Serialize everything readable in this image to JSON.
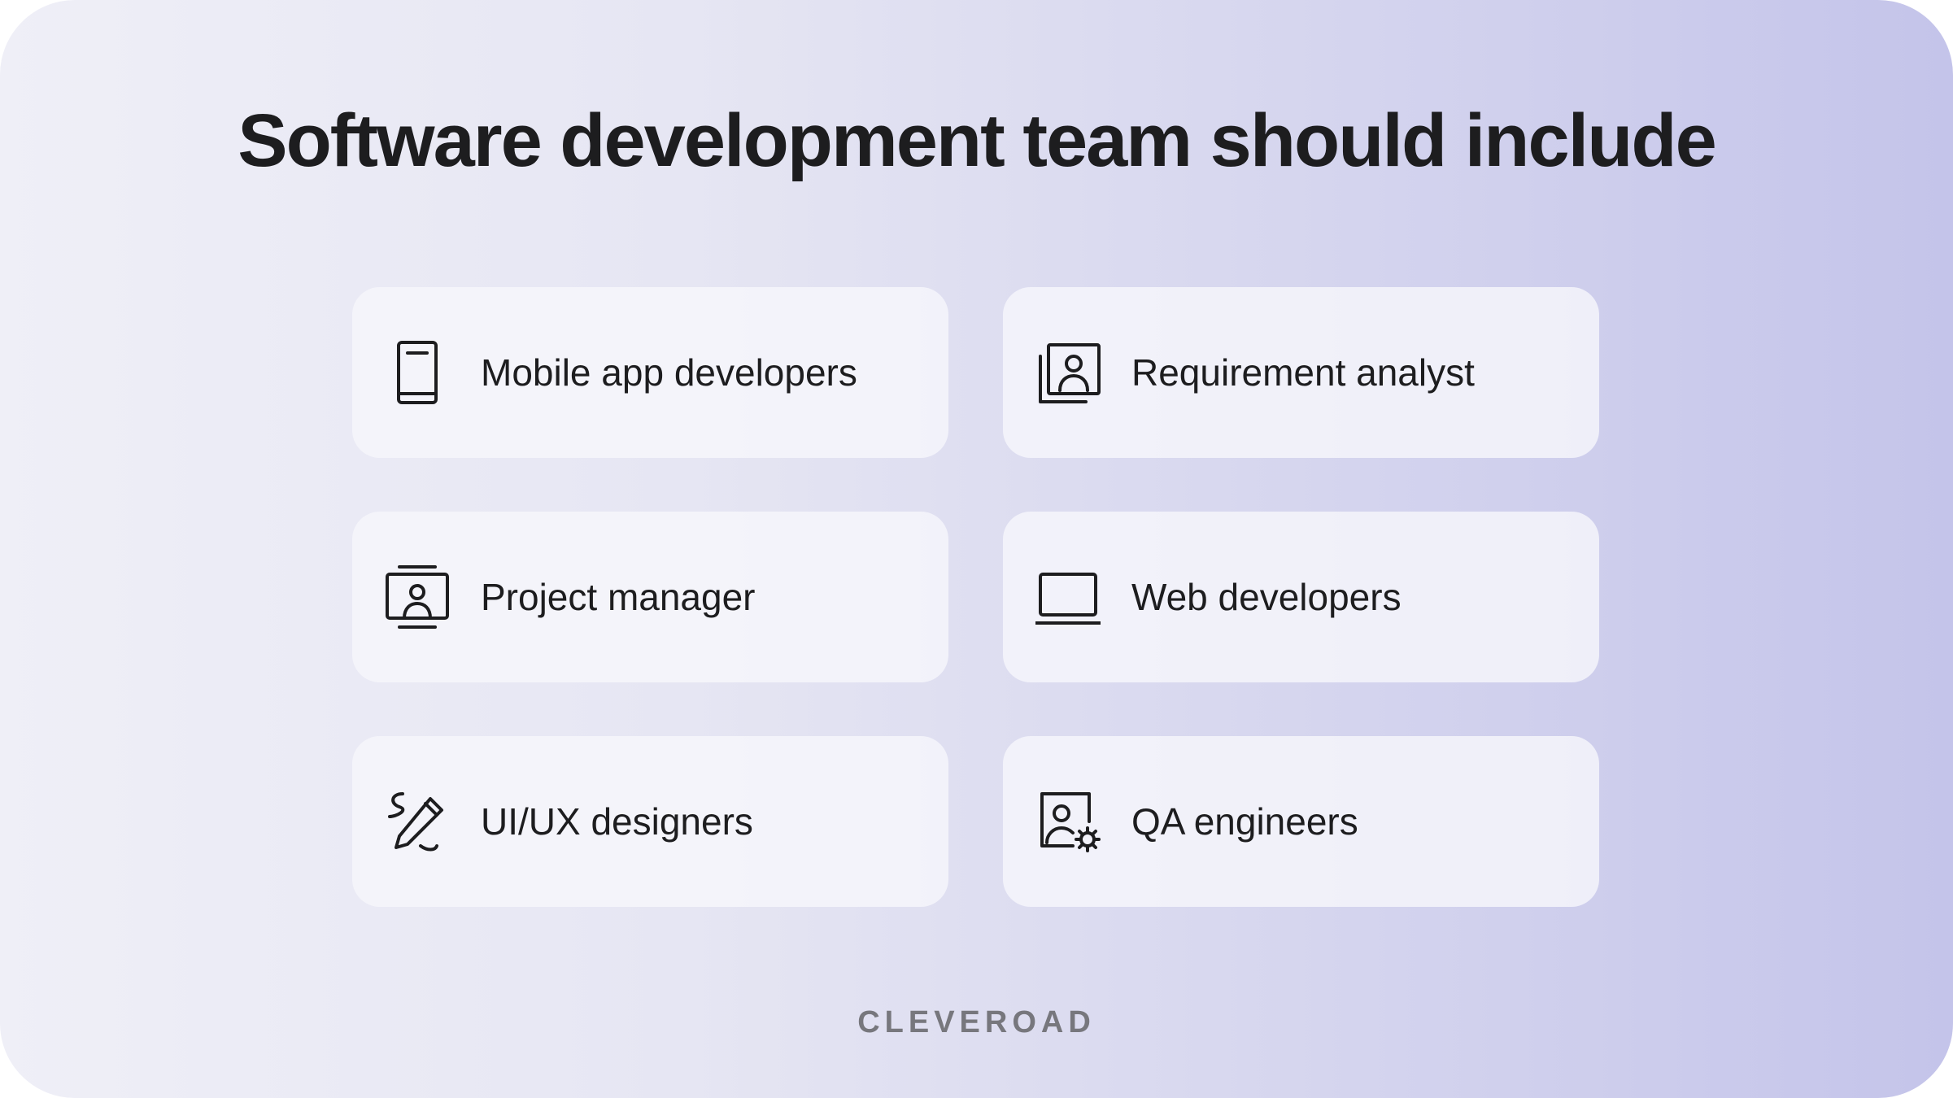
{
  "title": "Software development team should include",
  "cards": [
    {
      "label": "Mobile app developers",
      "icon": "mobile-phone-icon"
    },
    {
      "label": "Requirement analyst",
      "icon": "user-profile-document-icon"
    },
    {
      "label": "Project manager",
      "icon": "presenter-screen-icon"
    },
    {
      "label": "Web developers",
      "icon": "laptop-icon"
    },
    {
      "label": "UI/UX designers",
      "icon": "pen-squiggle-icon"
    },
    {
      "label": "QA engineers",
      "icon": "user-settings-gear-icon"
    }
  ],
  "brand": "CLEVEROAD",
  "colors": {
    "text": "#1d1d1f",
    "brand": "#77777d",
    "card": "#f6f6fb",
    "gradient_start": "#efeff7",
    "gradient_end": "#c4c4ea"
  }
}
